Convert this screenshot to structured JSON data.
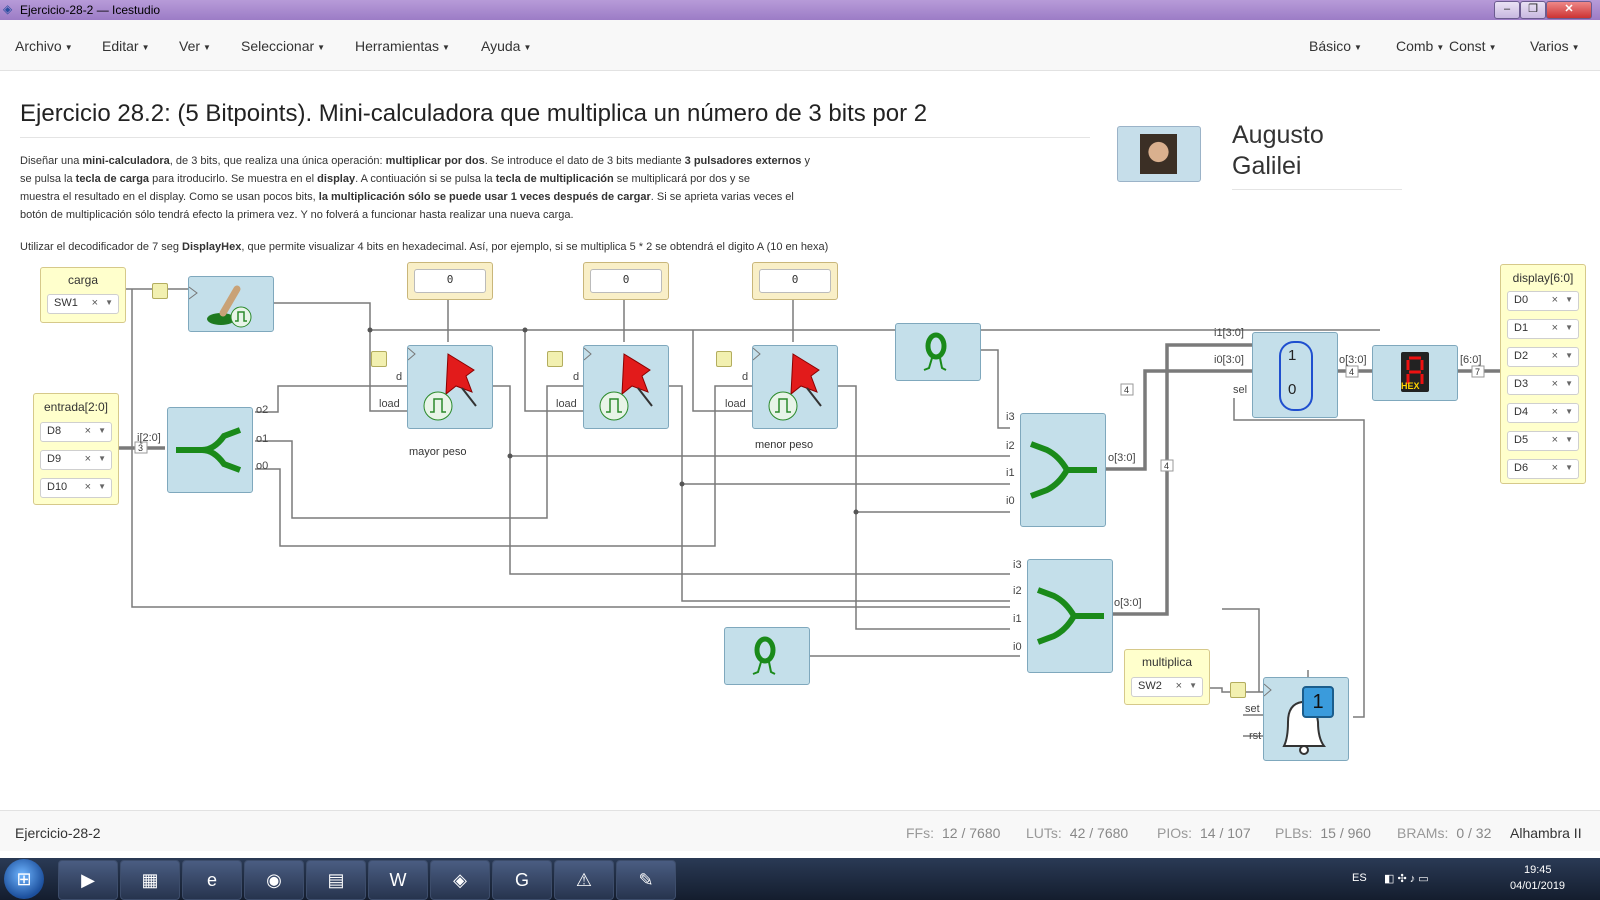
{
  "window": {
    "title": "Ejercicio-28-2 — Icestudio"
  },
  "menubar": {
    "left": [
      "Archivo",
      "Editar",
      "Ver",
      "Seleccionar",
      "Herramientas",
      "Ayuda"
    ],
    "right": [
      "Básico",
      "Comb",
      "Const",
      "Varios"
    ]
  },
  "info": {
    "heading": "Ejercicio 28.2: (5 Bitpoints). Mini-calculadora que multiplica un número de 3 bits por 2",
    "paragraph1": [
      [
        "Diseñar una ",
        "mini-calculadora",
        ", de 3 bits, que realiza una única operación: ",
        "multiplicar por dos",
        ". Se introduce el dato de 3 bits mediante ",
        "3 pulsadores externos",
        " y"
      ],
      [
        "se pulsa la ",
        "tecla de carga",
        " para itroducirlo. Se muestra en el ",
        "display",
        ". A contiuación si se pulsa la ",
        "tecla de multiplicación",
        " se multiplicará por dos y se"
      ],
      [
        "muestra el resultado en el display. Como se usan pocos bits, ",
        "la multiplicación sólo se puede usar 1 veces después de cargar",
        ". Si se aprieta varias veces el"
      ],
      [
        "botón de multiplicación sólo tendrá efecto la primera vez. Y no folverá a funcionar hasta realizar una nueva carga."
      ]
    ],
    "paragraph2": [
      "Utilizar el decodificador de 7 seg ",
      "DisplayHex",
      ", que permite visualizar 4 bits en hexadecimal. Así, por ejemplo, si se multiplica 5 * 2 se obtendrá el digito A (10 en hexa)"
    ],
    "author_line1": "Augusto",
    "author_line2": "Galilei"
  },
  "circuit": {
    "carga": {
      "label": "carga",
      "pin": "SW1"
    },
    "entrada": {
      "label": "entrada[2:0]",
      "pins": [
        "D8",
        "D9",
        "D10"
      ]
    },
    "multiplica": {
      "label": "multiplica",
      "pin": "SW2"
    },
    "display": {
      "label": "display[6:0]",
      "pins": [
        "D0",
        "D1",
        "D2",
        "D3",
        "D4",
        "D5",
        "D6"
      ]
    },
    "constants": [
      "0",
      "0",
      "0"
    ],
    "splitter_labels": {
      "in": "i[2:0]",
      "o2": "o2",
      "o1": "o1",
      "o0": "o0"
    },
    "reg_labels": {
      "d": "d",
      "load": "load"
    },
    "bit_labels": {
      "mayor": "mayor peso",
      "menor": "menor peso"
    },
    "join_labels": {
      "i3": "i3",
      "i2": "i2",
      "i1": "i1",
      "i0": "i0",
      "out": "o[3:0]"
    },
    "mux_labels": {
      "i1": "i1[3:0]",
      "i0": "i0[3:0]",
      "sel": "sel",
      "out": "o[3:0]",
      "one": "1",
      "zero": "0"
    },
    "hex_labels": {
      "out": "[6:0]",
      "tag": "HEX"
    },
    "ff_labels": {
      "set": "set",
      "rst": "rst",
      "value": "1"
    },
    "bus_widths": {
      "entrada": "3",
      "join_a": "4",
      "join_b": "4",
      "mux_out": "4",
      "hex_out": "7"
    }
  },
  "status": {
    "project": "Ejercicio-28-2",
    "stats": [
      {
        "label": "FFs:",
        "value": "12 / 7680"
      },
      {
        "label": "LUTs:",
        "value": "42 / 7680"
      },
      {
        "label": "PIOs:",
        "value": "14 / 107"
      },
      {
        "label": "PLBs:",
        "value": "15 / 960"
      },
      {
        "label": "BRAMs:",
        "value": "0 / 32"
      }
    ],
    "board": "Alhambra II"
  },
  "taskbar": {
    "lang": "ES",
    "time": "19:45",
    "date": "04/01/2019"
  }
}
